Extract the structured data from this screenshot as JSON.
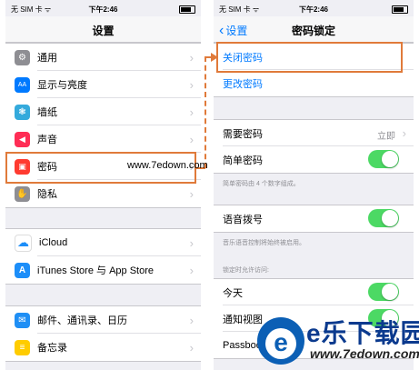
{
  "left": {
    "status": {
      "carrier": "无 SIM 卡 ᯤ",
      "time": "下午2:46"
    },
    "title": "设置",
    "group1": [
      {
        "label": "通用",
        "icon": "gear-icon",
        "color": "#8e8e93",
        "glyph": "⚙"
      },
      {
        "label": "显示与亮度",
        "icon": "brightness-icon",
        "color": "#007aff",
        "glyph": "AA"
      },
      {
        "label": "墙纸",
        "icon": "wallpaper-icon",
        "color": "#34aadc",
        "glyph": "❃"
      },
      {
        "label": "声音",
        "icon": "speaker-icon",
        "color": "#ff2d55",
        "glyph": "🔈"
      },
      {
        "label": "密码",
        "icon": "lock-icon",
        "color": "#ff3b30",
        "glyph": "🔒"
      },
      {
        "label": "隐私",
        "icon": "hand-icon",
        "color": "#8e8e93",
        "glyph": "✋"
      }
    ],
    "group2": [
      {
        "label": "iCloud",
        "icon": "cloud-icon",
        "color": "#ffffff",
        "glyph": "☁"
      },
      {
        "label": "iTunes Store 与 App Store",
        "icon": "appstore-icon",
        "color": "#1c8ef9",
        "glyph": "A"
      }
    ],
    "group3": [
      {
        "label": "邮件、通讯录、日历",
        "icon": "mail-icon",
        "color": "#1f8ff5",
        "glyph": "✉"
      },
      {
        "label": "备忘录",
        "icon": "notes-icon",
        "color": "#ffcc00",
        "glyph": "≡"
      }
    ]
  },
  "right": {
    "status": {
      "carrier": "无 SIM 卡 ᯤ",
      "time": "下午2:46"
    },
    "back": "设置",
    "title": "密码锁定",
    "actions": [
      "关闭密码",
      "更改密码"
    ],
    "require": {
      "label": "需要密码",
      "value": "立即"
    },
    "simple": {
      "label": "简单密码",
      "on": true
    },
    "simple_note": "简单密码由 4 个数字组成。",
    "voice": {
      "label": "语音拨号",
      "on": true
    },
    "voice_note": "音乐语音控制将始终被启用。",
    "lock_header": "锁定时允许访问:",
    "today": {
      "label": "今天",
      "on": true
    },
    "notif": {
      "label": "通知视图",
      "on": true
    },
    "passbook": {
      "label": "Passbook"
    }
  },
  "watermark": "www.7edown.com",
  "logo": {
    "name": "e乐下载园",
    "url": "www.7edown.com"
  },
  "accent": "#e07a3a"
}
